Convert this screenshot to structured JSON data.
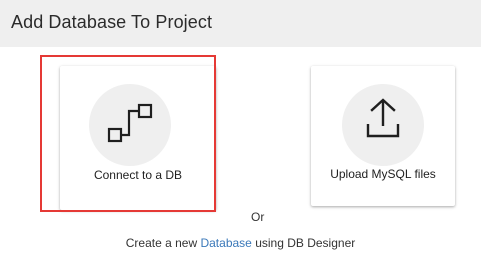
{
  "header": {
    "title": "Add Database To Project"
  },
  "cards": {
    "connect": {
      "label": "Connect to a DB",
      "icon": "connection-icon"
    },
    "upload": {
      "label": "Upload MySQL files",
      "icon": "upload-icon"
    }
  },
  "separator": {
    "or_label": "Or"
  },
  "create": {
    "prefix": "Create a new",
    "link_label": "Database",
    "suffix": "using DB Designer"
  },
  "colors": {
    "header_bg": "#efefef",
    "icon_circle_bg": "#efefef",
    "highlight_border": "#e53935",
    "link": "#3a78b9"
  }
}
